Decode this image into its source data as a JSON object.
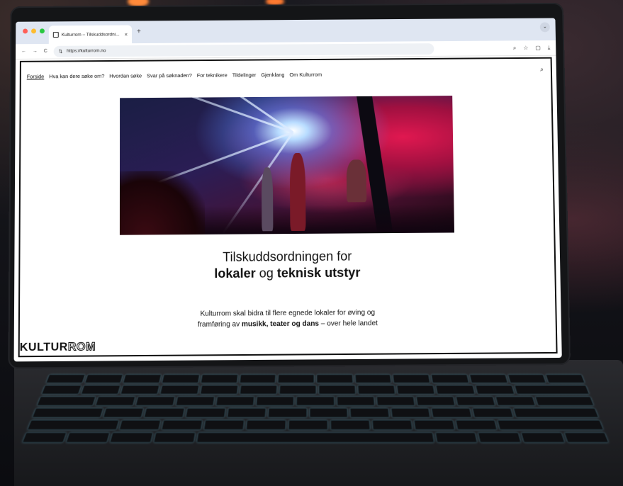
{
  "browser": {
    "tab_title": "Kulturrom – Tilskuddsordni...",
    "tab_close": "×",
    "new_tab": "+",
    "url": "https://kulturrom.no",
    "nav_back": "←",
    "nav_forward": "→",
    "reload": "C",
    "icons": [
      "search-icon",
      "star-icon",
      "extensions-icon",
      "download-icon"
    ]
  },
  "site": {
    "nav": {
      "items": [
        "Forside",
        "Hva kan dere søke om?",
        "Hvordan søke",
        "Svar på søknaden?",
        "For teknikere",
        "Tildelinger",
        "Gjenklang",
        "Om Kulturrom"
      ],
      "active": "Forside"
    },
    "headline": {
      "line1": "Tilskuddsordningen for",
      "bold1": "lokaler",
      "join": "og",
      "bold2": "teknisk utstyr"
    },
    "lead": {
      "line1": "Kulturrom skal bidra til flere egnede lokaler for øving og",
      "line2_start": "framføring av",
      "line2_bold": "musikk, teater og dans",
      "line2_end": "– over hele landet"
    },
    "logo": {
      "part1": "KULTUR",
      "part2": "ROM"
    }
  },
  "colors": {
    "accent": "#111111",
    "hero_red": "#e01850",
    "hero_blue": "#b8dcff"
  }
}
